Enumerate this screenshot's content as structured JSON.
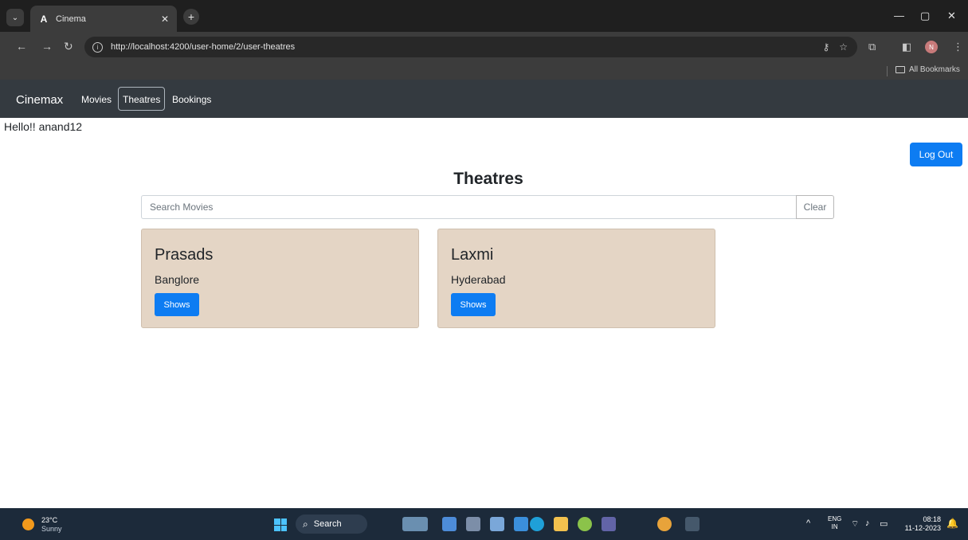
{
  "browser": {
    "tab_title": "Cinema",
    "tab_favicon": "A",
    "url": "http://localhost:4200/user-home/2/user-theatres",
    "profile_initial": "N",
    "bookmarks_label": "All Bookmarks"
  },
  "app": {
    "brand": "Cinemax",
    "nav": [
      {
        "label": "Movies",
        "active": false
      },
      {
        "label": "Theatres",
        "active": true
      },
      {
        "label": "Bookings",
        "active": false
      }
    ],
    "greeting": "Hello!! anand12",
    "logout_label": "Log Out",
    "accent_color": "#0d7cf2"
  },
  "main": {
    "title": "Theatres",
    "search_placeholder": "Search Movies",
    "clear_label": "Clear",
    "theatres": [
      {
        "name": "Prasads",
        "city": "Banglore",
        "button_label": "Shows"
      },
      {
        "name": "Laxmi",
        "city": "Hyderabad",
        "button_label": "Shows"
      }
    ]
  },
  "taskbar": {
    "weather_temp": "23°C",
    "weather_condition": "Sunny",
    "search_label": "Search",
    "lang_top": "ENG",
    "lang_bottom": "IN",
    "time": "08:18",
    "date": "11-12-2023"
  }
}
